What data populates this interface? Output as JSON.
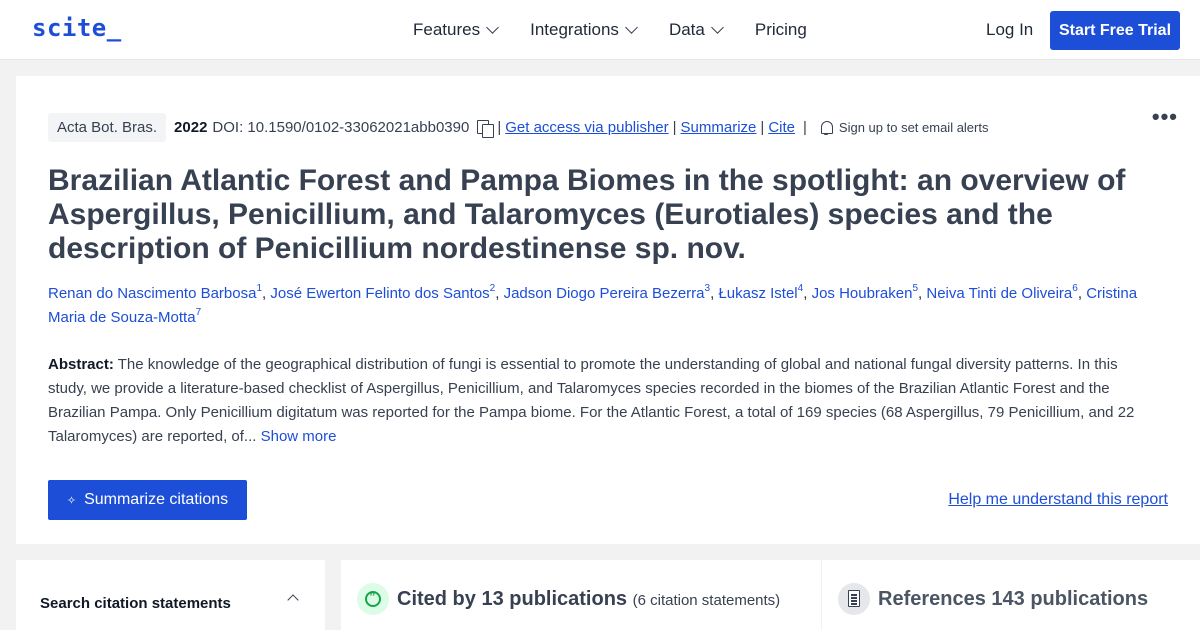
{
  "nav": {
    "logo": "scite_",
    "menu": [
      {
        "label": "Features"
      },
      {
        "label": "Integrations"
      },
      {
        "label": "Data"
      },
      {
        "label": "Pricing"
      }
    ],
    "login": "Log In",
    "trial": "Start Free Trial"
  },
  "paper": {
    "journal": "Acta Bot. Bras.",
    "year": "2022",
    "doi": "DOI: 10.1590/0102-33062021abb0390",
    "sep": "|",
    "get_access": "Get access via publisher",
    "summarize": "Summarize",
    "cite": "Cite",
    "alerts": "Sign up to set email alerts",
    "more": "•••",
    "title": "Brazilian Atlantic Forest and Pampa Biomes in the spotlight: an overview of Aspergillus, Penicillium, and Talaromyces (Eurotiales) species and the description of Penicillium nordestinense sp. nov.",
    "authors": [
      {
        "name": "Renan do Nascimento Barbosa",
        "sup": "1"
      },
      {
        "name": "José Ewerton Felinto dos Santos",
        "sup": "2"
      },
      {
        "name": "Jadson Diogo Pereira Bezerra",
        "sup": "3"
      },
      {
        "name": "Łukasz Istel",
        "sup": "4"
      },
      {
        "name": "Jos Houbraken",
        "sup": "5"
      },
      {
        "name": "Neiva Tinti de Oliveira",
        "sup": "6"
      },
      {
        "name": "Cristina Maria de Souza-Motta",
        "sup": "7"
      }
    ],
    "abstract_label": "Abstract:",
    "abstract": "The knowledge of the geographical distribution of fungi is essential to promote the understanding of global and national fungal diversity patterns. In this study, we provide a literature-based checklist of Aspergillus, Penicillium, and Talaromyces species recorded in the biomes of the Brazilian Atlantic Forest and the Brazilian Pampa. Only Penicillium digitatum was reported for the Pampa biome. For the Atlantic Forest, a total of 169 species (68 Aspergillus, 79 Penicillium, and 22 Talaromyces) are reported, of...",
    "show_more": "Show more",
    "summarize_citations": "Summarize citations",
    "help": "Help me understand this report"
  },
  "panels": {
    "search_title": "Search citation statements",
    "cited_by": "Cited by 13 publications",
    "cited_sub": "(6 citation statements)",
    "references": "References 143 publications"
  }
}
